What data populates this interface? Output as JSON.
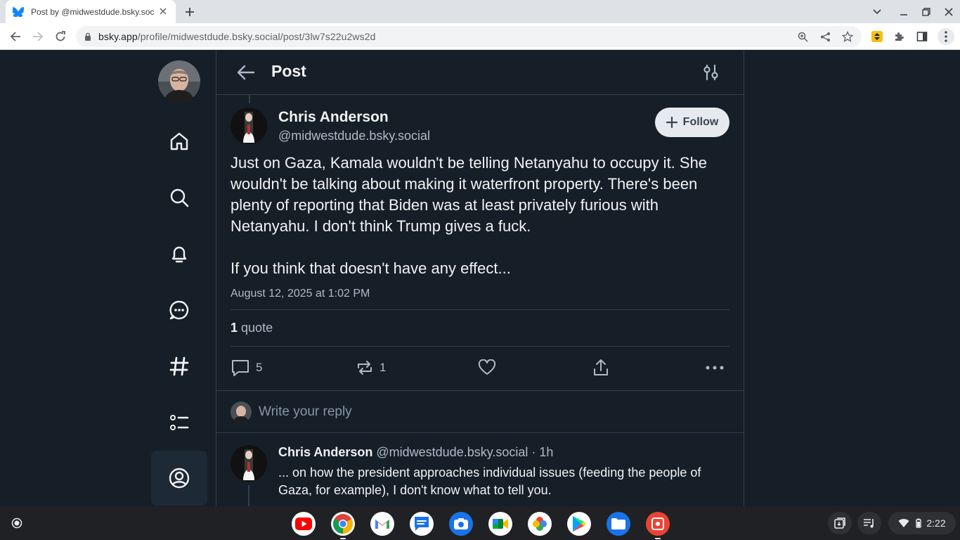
{
  "browser": {
    "tab_title": "Post by @midwestdude.bsky.social",
    "url_host": "bsky.app",
    "url_path": "/profile/midwestdude.bsky.social/post/3lw7s22u2ws2d"
  },
  "header": {
    "title": "Post"
  },
  "post": {
    "author_name": "Chris Anderson",
    "author_handle": "@midwestdude.bsky.social",
    "follow_label": "Follow",
    "text": "Just on Gaza, Kamala wouldn't be telling Netanyahu to occupy it. She wouldn't be talking about making it waterfront property. There's been plenty of reporting that Biden was at least privately furious with Netanyahu. I don't think Trump gives a fuck.\n\nIf you think that doesn't have any effect...",
    "timestamp": "August 12, 2025 at 1:02 PM",
    "quote_count": "1",
    "quote_label": "quote",
    "reply_count": "5",
    "repost_count": "1"
  },
  "reply_box": {
    "placeholder": "Write your reply"
  },
  "child_post": {
    "author_name": "Chris Anderson",
    "author_handle": "@midwestdude.bsky.social",
    "age": "· 1h",
    "text": "... on how the president approaches individual issues (feeding the people of Gaza, for example), I don't know what to tell you."
  },
  "shelf": {
    "apps": [
      "youtube-icon",
      "chrome-icon",
      "gmail-icon",
      "messages-icon",
      "camera-icon",
      "meet-icon",
      "photos-icon",
      "play-store-icon",
      "files-icon",
      "screencast-icon"
    ],
    "time": "2:22"
  },
  "colors": {
    "background": "#161e27",
    "border": "#2e4052",
    "text": "#f1f3f5",
    "muted": "#aebbc9"
  }
}
